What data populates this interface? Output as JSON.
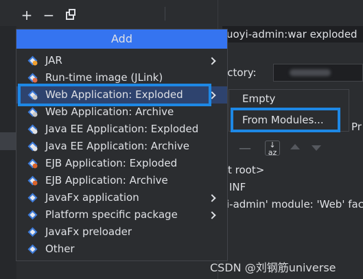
{
  "toolbar": {
    "add_symbol": "+",
    "remove_symbol": "−"
  },
  "artifact": {
    "name": "uoyi-admin:war exploded",
    "output_directory_label": "ectory:",
    "right_partial": "Pr"
  },
  "tree": {
    "lines": [
      "t root>",
      "INF",
      "i-admin' module: 'Web' face"
    ]
  },
  "popup": {
    "title": "Add",
    "items": [
      {
        "label": "JAR",
        "icon": "jar-icon",
        "has_submenu": true
      },
      {
        "label": "Run-time image (JLink)",
        "icon": "runtime-image-icon",
        "has_submenu": false
      },
      {
        "label": "Web Application: Exploded",
        "icon": "web-app-icon",
        "has_submenu": true,
        "selected": true
      },
      {
        "label": "Web Application: Archive",
        "icon": "web-app-icon",
        "has_submenu": false
      },
      {
        "label": "Java EE Application: Exploded",
        "icon": "javaee-icon",
        "has_submenu": false
      },
      {
        "label": "Java EE Application: Archive",
        "icon": "javaee-icon",
        "has_submenu": false
      },
      {
        "label": "EJB Application: Exploded",
        "icon": "ejb-icon",
        "has_submenu": false
      },
      {
        "label": "EJB Application: Archive",
        "icon": "ejb-icon",
        "has_submenu": false
      },
      {
        "label": "JavaFx application",
        "icon": "javafx-icon",
        "has_submenu": true
      },
      {
        "label": "Platform specific package",
        "icon": "platform-icon",
        "has_submenu": true
      },
      {
        "label": "JavaFx preloader",
        "icon": "javafx-icon",
        "has_submenu": false
      },
      {
        "label": "Other",
        "icon": "other-icon",
        "has_submenu": false
      }
    ]
  },
  "submenu": {
    "items": [
      {
        "label": "Empty"
      },
      {
        "label": "From Modules..."
      }
    ]
  },
  "watermark": "CSDN @刘钢筋universe",
  "colors": {
    "accent": "#3574f0",
    "highlight_box": "#1e88e5",
    "selected_row": "#2e436e",
    "background": "#2b2d30"
  }
}
